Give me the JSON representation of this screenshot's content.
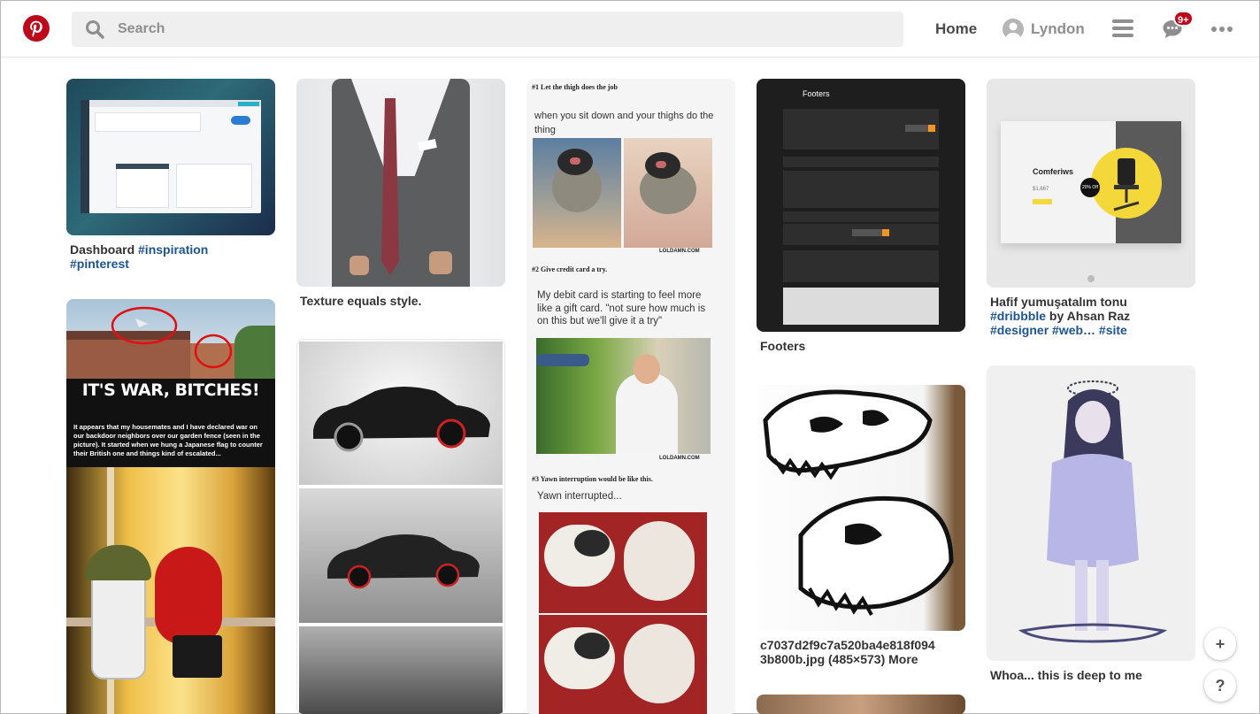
{
  "header": {
    "search_placeholder": "Search",
    "home_label": "Home",
    "user_name": "Lyndon",
    "notifications_badge": "9+",
    "brand_color": "#bd081c"
  },
  "pins": [
    {
      "id": "dashboard",
      "parts": [
        {
          "text": "Dashboard ",
          "tag": false
        },
        {
          "text": "#inspiration",
          "tag": true
        },
        {
          "text": "#pinterest",
          "tag": true
        }
      ]
    },
    {
      "id": "texture",
      "parts": [
        {
          "text": "Texture equals style.",
          "tag": false
        }
      ]
    },
    {
      "id": "footers",
      "parts": [
        {
          "text": "Footers",
          "tag": false
        }
      ]
    },
    {
      "id": "hafif",
      "parts": [
        {
          "text": "Hafif yumuşatalım tonu",
          "tag": false
        },
        {
          "text": "#dribbble",
          "tag": true
        },
        {
          "text": " by Ahsan Raz",
          "tag": false
        },
        {
          "text": "#designer #web… #site",
          "tag": true
        }
      ]
    },
    {
      "id": "dino",
      "parts": [
        {
          "text": "c7037d2f9c7a520ba4e818f094 3b800b.jpg (485×573) More",
          "tag": false
        }
      ]
    },
    {
      "id": "whoa",
      "parts": [
        {
          "text": "Whoa... this is deep to me",
          "tag": false
        }
      ]
    }
  ],
  "war_pin": {
    "headline": "IT'S WAR, BITCHES!",
    "body": "It appears that my housemates and I have declared war on our backdoor neighbors over our garden fence (seen in the picture). It started when we hung a Japanese flag to counter their British one and things kind of escalated..."
  },
  "meme_pin": {
    "step1_title": "#1 Let the thigh does the job",
    "step1_text": "when you sit down and your thighs do the thing",
    "watermark": "LOLDAMN.COM",
    "step2_title": "#2 Give credit card a try.",
    "step2_text": "My debit card is starting to feel more like a gift card. \"not sure how much is on this but we'll give it a try\"",
    "step3_title": "#3 Yawn interruption would be like this.",
    "step3_text": "Yawn interrupted..."
  },
  "footers_mock_title": "Footers",
  "chair_mock": {
    "product": "Comferiws",
    "price": "$1,667",
    "discount": "20% Off"
  },
  "fab": {
    "add": "+",
    "help": "?"
  }
}
